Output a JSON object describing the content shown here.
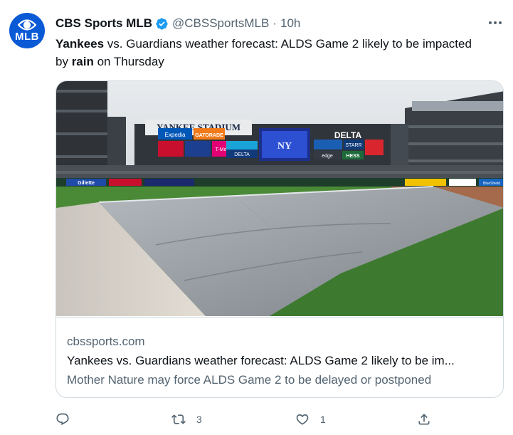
{
  "tweet": {
    "author_name": "CBS Sports MLB",
    "handle": "@CBSSportsMLB",
    "separator": "·",
    "time": "10h",
    "avatar_text": "MLB",
    "text_parts": {
      "p1": "Yankees",
      "p2": " vs. Guardians weather forecast: ALDS Game 2 likely to be impacted by ",
      "p3": "rain",
      "p4": " on Thursday"
    }
  },
  "card": {
    "domain": "cbssports.com",
    "title": "Yankees vs. Guardians weather forecast: ALDS Game 2 likely to be im...",
    "description": "Mother Nature may force ALDS Game 2 to be delayed or postponed",
    "image": {
      "stadium_sign": "YANKEE STADIUM",
      "delta": "DELTA",
      "gatorade": "GATORADE",
      "mobile": "T-Mobile",
      "delta_small": "DELTA",
      "hess": "HESS",
      "starr": "STARR",
      "edge": "edge",
      "gillette": "Gillette",
      "expedia": "Expedia",
      "blue_shield": "BlueShield"
    }
  },
  "actions": {
    "reply_count": "",
    "retweet_count": "3",
    "like_count": "1"
  },
  "icons": {
    "avatar": "cbs-eye-icon",
    "verified": "verified-badge-icon",
    "more": "more-options-icon",
    "reply": "reply-icon",
    "retweet": "retweet-icon",
    "like": "heart-icon",
    "share": "share-icon"
  },
  "colors": {
    "avatar_bg": "#0a5ad6",
    "verified": "#1d9bf0",
    "secondary_text": "#536471",
    "border": "#cfd9de"
  }
}
